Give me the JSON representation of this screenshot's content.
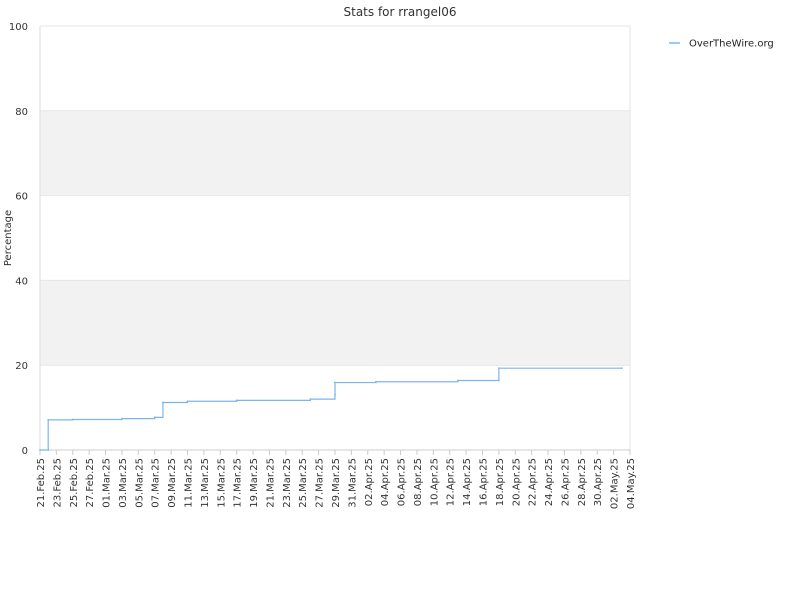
{
  "chart_data": {
    "type": "line",
    "title": "Stats for rrangel06",
    "xlabel": "",
    "ylabel": "Percentage",
    "ylim": [
      0,
      100
    ],
    "yticks": [
      0,
      20,
      40,
      60,
      80,
      100
    ],
    "xlim": [
      "2025-02-21",
      "2025-05-04"
    ],
    "xtick_labels": [
      "21.Feb.25",
      "23.Feb.25",
      "25.Feb.25",
      "27.Feb.25",
      "01.Mar.25",
      "03.Mar.25",
      "05.Mar.25",
      "07.Mar.25",
      "09.Mar.25",
      "11.Mar.25",
      "13.Mar.25",
      "15.Mar.25",
      "17.Mar.25",
      "19.Mar.25",
      "21.Mar.25",
      "23.Mar.25",
      "25.Mar.25",
      "27.Mar.25",
      "29.Mar.25",
      "31.Mar.25",
      "02.Apr.25",
      "04.Apr.25",
      "06.Apr.25",
      "08.Apr.25",
      "10.Apr.25",
      "12.Apr.25",
      "14.Apr.25",
      "16.Apr.25",
      "18.Apr.25",
      "20.Apr.25",
      "22.Apr.25",
      "24.Apr.25",
      "26.Apr.25",
      "28.Apr.25",
      "30.Apr.25",
      "02.May.25",
      "04.May.25"
    ],
    "grid": "horizontal alternating bands",
    "legend_position": "top-right",
    "series": [
      {
        "name": "OverTheWire.org",
        "color": "#7cb5ec",
        "step": true,
        "points": [
          [
            "2025-02-21",
            0
          ],
          [
            "2025-02-22",
            0
          ],
          [
            "2025-02-22",
            7.1
          ],
          [
            "2025-02-25",
            7.2
          ],
          [
            "2025-03-03",
            7.4
          ],
          [
            "2025-03-07",
            7.7
          ],
          [
            "2025-03-08",
            11.2
          ],
          [
            "2025-03-11",
            11.5
          ],
          [
            "2025-03-17",
            11.7
          ],
          [
            "2025-03-26",
            12.0
          ],
          [
            "2025-03-29",
            13.0
          ],
          [
            "2025-03-29",
            15.9
          ],
          [
            "2025-04-03",
            16.1
          ],
          [
            "2025-04-13",
            16.4
          ],
          [
            "2025-04-18",
            16.4
          ],
          [
            "2025-04-18",
            19.3
          ],
          [
            "2025-05-03",
            19.3
          ]
        ]
      }
    ]
  }
}
